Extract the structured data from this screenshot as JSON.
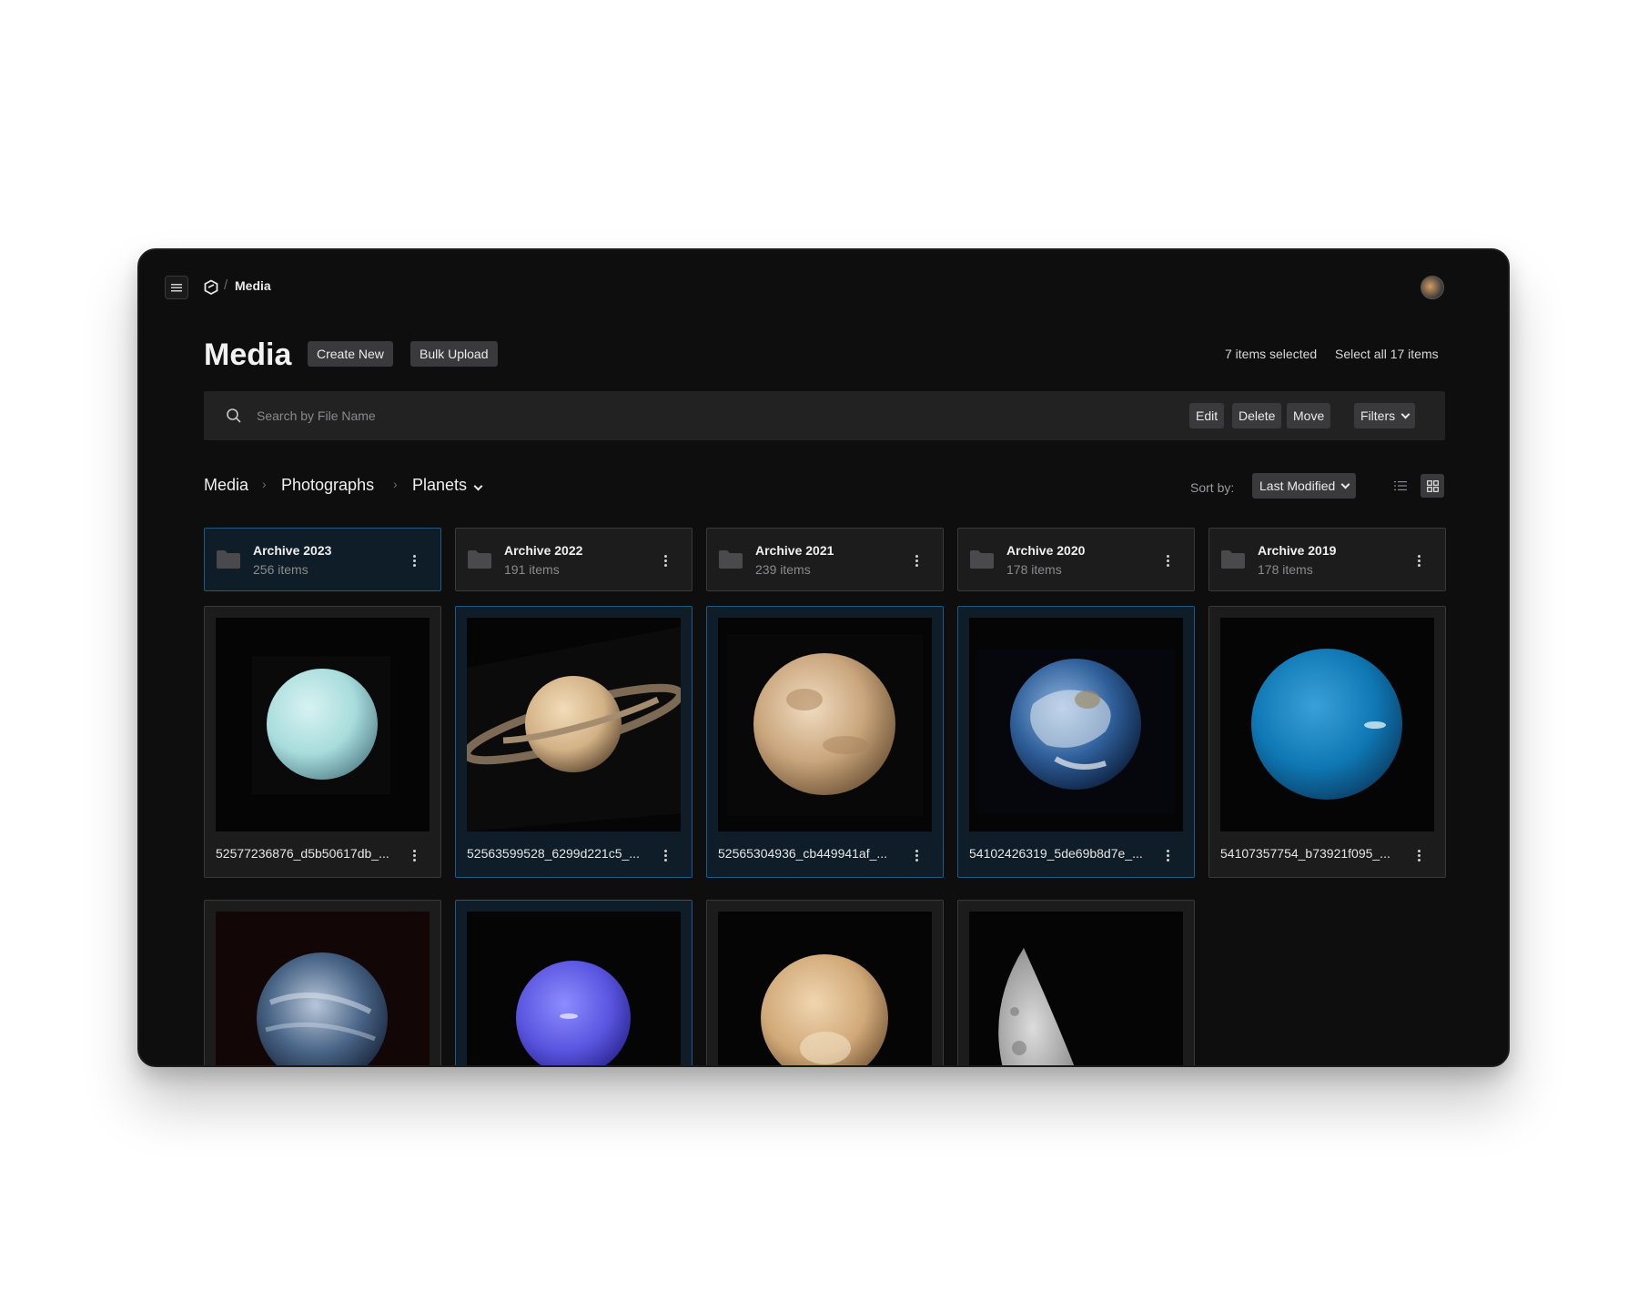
{
  "topbar": {
    "crumb": "Media",
    "crumb_sep": "/"
  },
  "header": {
    "title": "Media",
    "create_new": "Create New",
    "bulk_upload": "Bulk Upload",
    "selected_count": "7 items selected",
    "select_all": "Select all 17 items"
  },
  "search": {
    "placeholder": "Search by File Name",
    "edit": "Edit",
    "delete": "Delete",
    "move": "Move",
    "filters": "Filters"
  },
  "path": {
    "items": [
      "Media",
      "Photographs",
      "Planets"
    ],
    "sep": "›"
  },
  "sort": {
    "label": "Sort by:",
    "value": "Last Modified"
  },
  "folders": [
    {
      "name": "Archive 2023",
      "count": "256 items",
      "selected": true
    },
    {
      "name": "Archive 2022",
      "count": "191 items",
      "selected": false
    },
    {
      "name": "Archive 2021",
      "count": "239 items",
      "selected": false
    },
    {
      "name": "Archive 2020",
      "count": "178 items",
      "selected": false
    },
    {
      "name": "Archive 2019",
      "count": "178 items",
      "selected": false
    }
  ],
  "files": [
    {
      "name": "52577236876_d5b50617db_...",
      "selected": false,
      "subject": "uranus"
    },
    {
      "name": "52563599528_6299d221c5_...",
      "selected": true,
      "subject": "saturn"
    },
    {
      "name": "52565304936_cb449941af_...",
      "selected": true,
      "subject": "mars"
    },
    {
      "name": "54102426319_5de69b8d7e_...",
      "selected": true,
      "subject": "earth"
    },
    {
      "name": "54107357754_b73921f095_...",
      "selected": false,
      "subject": "neptune"
    },
    {
      "name": "",
      "selected": false,
      "subject": "venus"
    },
    {
      "name": "",
      "selected": true,
      "subject": "neptune-violet"
    },
    {
      "name": "",
      "selected": false,
      "subject": "pluto"
    },
    {
      "name": "",
      "selected": false,
      "subject": "moon"
    }
  ],
  "colors": {
    "accent_border": "#1c5b86",
    "window_bg": "#0e0e0f"
  }
}
